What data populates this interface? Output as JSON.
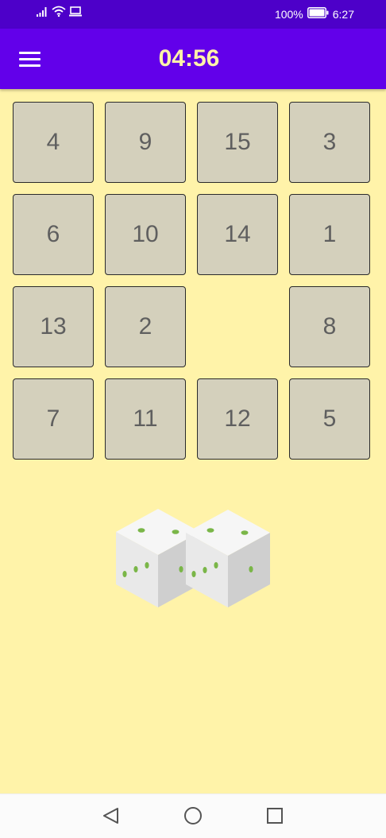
{
  "status_bar": {
    "battery_percent": "100%",
    "time": "6:27",
    "icons": [
      "signal-icon",
      "wifi-icon",
      "laptop-icon",
      "battery-icon"
    ],
    "colors": {
      "background": "#4d00c9"
    }
  },
  "app_bar": {
    "timer": "04:56",
    "menu_icon": "hamburger-menu-icon",
    "colors": {
      "background": "#6200ea",
      "timer_text": "#fff3a9"
    }
  },
  "board": {
    "rows": 4,
    "cols": 4,
    "tiles": [
      [
        4,
        9,
        15,
        3
      ],
      [
        6,
        10,
        14,
        1
      ],
      [
        13,
        2,
        null,
        8
      ],
      [
        7,
        11,
        12,
        5
      ]
    ],
    "colors": {
      "tile": "#d4d0bc",
      "tile_text": "#5f5f5f",
      "background": "#fff3a9"
    }
  },
  "illustration": {
    "icon": "two-dice-icon",
    "pip_color": "#7ab648"
  },
  "nav_bar": {
    "buttons": [
      "back-icon",
      "home-icon",
      "recents-icon"
    ]
  }
}
